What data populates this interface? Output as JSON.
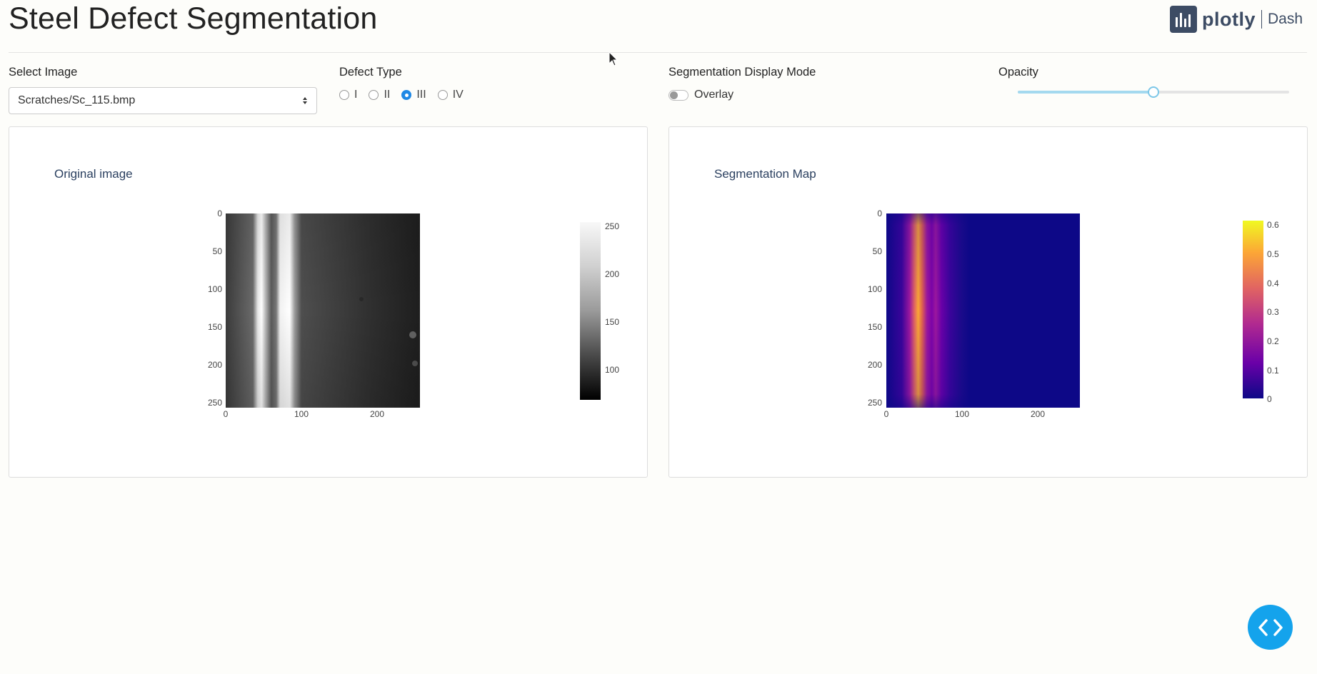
{
  "header": {
    "title": "Steel Defect Segmentation",
    "logo": {
      "icon": "plotly-logo-icon",
      "word": "plotly",
      "product": "Dash"
    }
  },
  "controls": {
    "select_image": {
      "label": "Select Image",
      "value": "Scratches/Sc_115.bmp"
    },
    "defect_type": {
      "label": "Defect Type",
      "options": [
        {
          "label": "I",
          "checked": false
        },
        {
          "label": "II",
          "checked": false
        },
        {
          "label": "III",
          "checked": true
        },
        {
          "label": "IV",
          "checked": false
        }
      ]
    },
    "display_mode": {
      "label": "Segmentation Display Mode",
      "toggle_label": "Overlay",
      "on": false
    },
    "opacity": {
      "label": "Opacity",
      "value": 0.5
    }
  },
  "panels": {
    "original": {
      "title": "Original image",
      "y_ticks": [
        "0",
        "50",
        "100",
        "150",
        "200",
        "250"
      ],
      "x_ticks": [
        "0",
        "100",
        "200"
      ],
      "colorbar_ticks": [
        "250",
        "200",
        "150",
        "100"
      ]
    },
    "segmentation": {
      "title": "Segmentation Map",
      "y_ticks": [
        "0",
        "50",
        "100",
        "150",
        "200",
        "250"
      ],
      "x_ticks": [
        "0",
        "100",
        "200"
      ],
      "colorbar_ticks": [
        "0.6",
        "0.5",
        "0.4",
        "0.3",
        "0.2",
        "0.1",
        "0"
      ]
    }
  },
  "colors": {
    "accent": "#1e88e5",
    "code_button": "#14a3ec",
    "plasma_low": "#0d0887",
    "plasma_high": "#f0f921"
  },
  "code_button": {
    "icon": "code-brackets-icon"
  }
}
